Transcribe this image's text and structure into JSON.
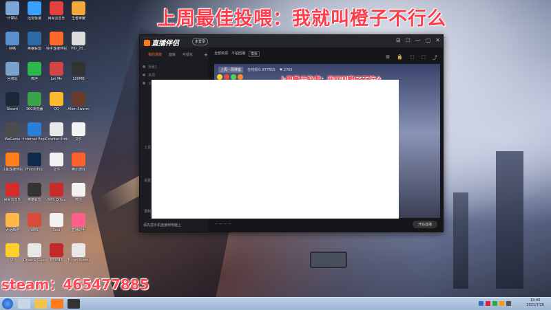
{
  "overlay": {
    "title": "上周最佳投喂：我就叫橙子不行么",
    "steam": "steam：465477885"
  },
  "desktop_icons": [
    {
      "label": "计算机",
      "color": "#7aa7d8"
    },
    {
      "label": "迅雷极速",
      "color": "#3aa0ff"
    },
    {
      "label": "网易云音乐",
      "color": "#e34040"
    },
    {
      "label": "王者荣耀",
      "color": "#f2a93b"
    },
    {
      "label": "网络",
      "color": "#5a8fd0"
    },
    {
      "label": "英雄联盟",
      "color": "#2e6aa8"
    },
    {
      "label": "快手直播伴侣",
      "color": "#ff6a2a"
    },
    {
      "label": "VID_20...",
      "color": "#dddddd"
    },
    {
      "label": "回收站",
      "color": "#7aa3cc"
    },
    {
      "label": "微信",
      "color": "#2db84d"
    },
    {
      "label": "Let Me",
      "color": "#d24545"
    },
    {
      "label": "100MB",
      "color": "#333333"
    },
    {
      "label": "Steam",
      "color": "#1b2838"
    },
    {
      "label": "360浏览器",
      "color": "#39a24a"
    },
    {
      "label": "QQ",
      "color": "#ffb730"
    },
    {
      "label": "Alien Swarm",
      "color": "#6b3b2b"
    },
    {
      "label": "WeGame",
      "color": "#4c4c4c"
    },
    {
      "label": "Internet Explorer",
      "color": "#2c7fd6"
    },
    {
      "label": "Counter-Strike Global Off",
      "color": "#e8e8e8"
    },
    {
      "label": "文件",
      "color": "#f2f2f2"
    },
    {
      "label": "斗鱼直播伴侣",
      "color": "#ff7f1a"
    },
    {
      "label": "Photoshop",
      "color": "#0e2b4d"
    },
    {
      "label": "文件",
      "color": "#f2f2f2"
    },
    {
      "label": "腾讯游戏",
      "color": "#ff5f2a"
    },
    {
      "label": "网易云音乐",
      "color": "#d62b2b"
    },
    {
      "label": "英雄联盟",
      "color": "#333333"
    },
    {
      "label": "WPS Office",
      "color": "#c82b2b"
    },
    {
      "label": "微信",
      "color": "#f2f2f2"
    },
    {
      "label": "大话西游",
      "color": "#ffb74a"
    },
    {
      "label": "WPS",
      "color": "#d94a3a"
    },
    {
      "label": "Soul",
      "color": "#f2f2f2"
    },
    {
      "label": "直播助手",
      "color": "#ff5f8a"
    },
    {
      "label": "VR",
      "color": "#ffd02a"
    },
    {
      "label": "Draw & Guess",
      "color": "#e8e8e8"
    },
    {
      "label": "877815",
      "color": "#c22a2a"
    },
    {
      "label": "Trojan Accurate",
      "color": "#e8e8e8"
    }
  ],
  "app": {
    "logo": "直播伴侣",
    "badge": "未登录",
    "window_controls": [
      "⊟",
      "☐",
      "—",
      "▢",
      "✕"
    ],
    "tabs": [
      "我的场景",
      "面板",
      "可视化"
    ],
    "add_tab": "+",
    "side_rows": [
      "场景1",
      "来源",
      "文本"
    ],
    "side_tools": [
      "工具",
      "设置",
      "录制"
    ],
    "toolbar": [
      "全部资源",
      "不拍回播",
      "模板"
    ],
    "right_tools": [
      "⊞",
      "🔒",
      "⬚",
      "⬚",
      "⤴"
    ],
    "preview_buttons": {
      "primary": "上周一周排座",
      "viewers": "在线观众 877815",
      "likes": "♥ 2765"
    },
    "preview_title": "上周最佳投喂：我就叫橙子不行么",
    "status_text": "请先把手机连接到电脑上",
    "live_button": "开始直播"
  },
  "taskbar": {
    "time": "19:40",
    "date": "2021/7/20"
  }
}
